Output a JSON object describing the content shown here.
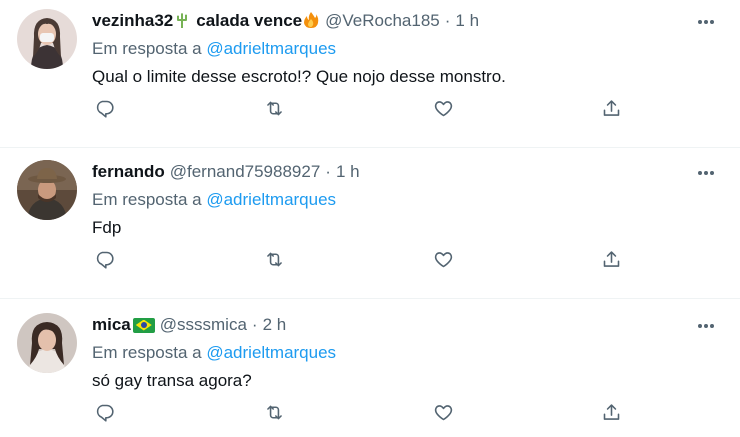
{
  "tweets": [
    {
      "display_name": "vezinha32",
      "name_suffix": "calada vence",
      "emoji_1": "cactus",
      "emoji_2": "fire",
      "handle": "@VeRocha185",
      "dot": "·",
      "time": "1 h",
      "reply_prefix": "Em resposta a",
      "reply_mention": "@adrieltmarques",
      "text": "Qual o limite desse escroto!? Que nojo desse monstro."
    },
    {
      "display_name": "fernando",
      "handle": "@fernand75988927",
      "dot": "·",
      "time": "1 h",
      "reply_prefix": "Em resposta a",
      "reply_mention": "@adrieltmarques",
      "text": "Fdp"
    },
    {
      "display_name": "mica",
      "flag": "brazil-flag",
      "handle": "@ssssmica",
      "dot": "·",
      "time": "2 h",
      "reply_prefix": "Em resposta a",
      "reply_mention": "@adrieltmarques",
      "text": "só gay transa agora?"
    }
  ],
  "icons": {
    "more": "more-horizontal-icon",
    "reply": "reply-icon",
    "retweet": "retweet-icon",
    "like": "like-icon",
    "share": "share-icon"
  },
  "colors": {
    "text": "#0f1419",
    "secondary": "#536471",
    "mention": "#1d9bf0",
    "divider": "#eff3f4"
  }
}
